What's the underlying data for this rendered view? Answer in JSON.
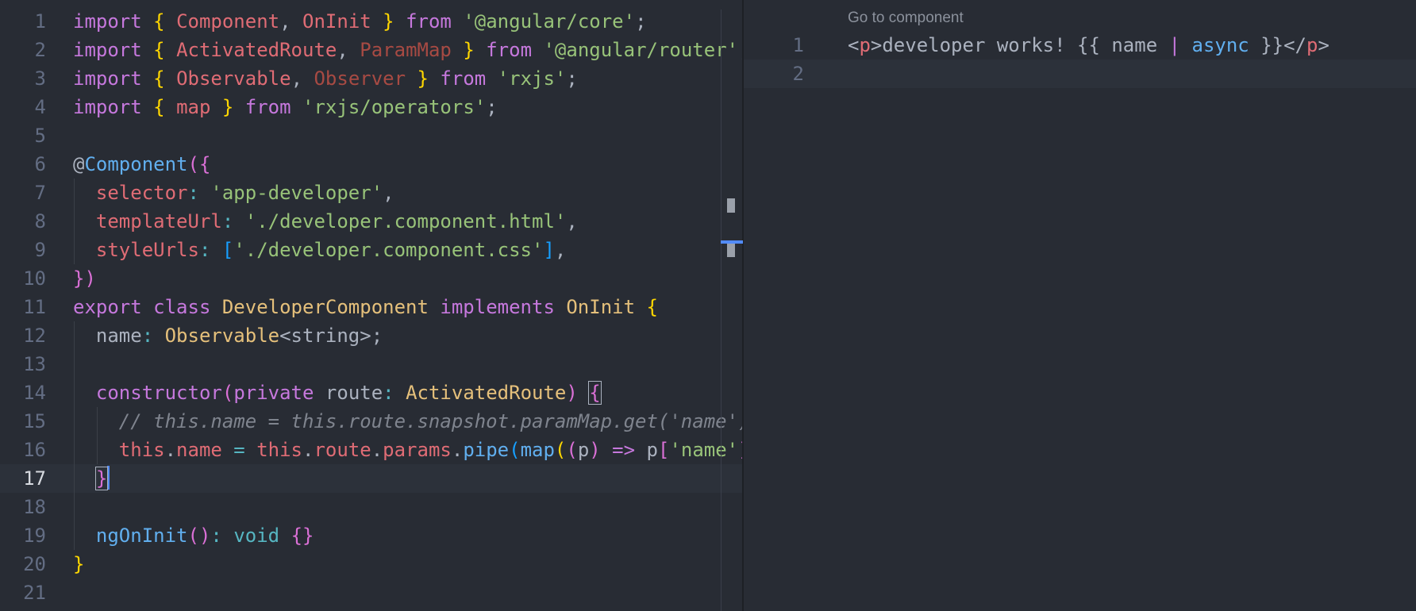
{
  "left_editor": {
    "active_line": 17,
    "line_numbers": [
      "1",
      "2",
      "3",
      "4",
      "5",
      "6",
      "7",
      "8",
      "9",
      "10",
      "11",
      "12",
      "13",
      "14",
      "15",
      "16",
      "17",
      "18",
      "19",
      "20",
      "21"
    ],
    "lines": [
      [
        {
          "t": "import",
          "c": "k"
        },
        {
          "t": " ",
          "c": "p"
        },
        {
          "t": "{",
          "c": "b1"
        },
        {
          "t": " ",
          "c": "p"
        },
        {
          "t": "Component",
          "c": "r"
        },
        {
          "t": ", ",
          "c": "p"
        },
        {
          "t": "OnInit",
          "c": "r"
        },
        {
          "t": " ",
          "c": "p"
        },
        {
          "t": "}",
          "c": "b1"
        },
        {
          "t": " ",
          "c": "p"
        },
        {
          "t": "from",
          "c": "k"
        },
        {
          "t": " ",
          "c": "p"
        },
        {
          "t": "'@angular/core'",
          "c": "s"
        },
        {
          "t": ";",
          "c": "p"
        }
      ],
      [
        {
          "t": "import",
          "c": "k"
        },
        {
          "t": " ",
          "c": "p"
        },
        {
          "t": "{",
          "c": "b1"
        },
        {
          "t": " ",
          "c": "p"
        },
        {
          "t": "ActivatedRoute",
          "c": "r"
        },
        {
          "t": ", ",
          "c": "p"
        },
        {
          "t": "ParamMap",
          "c": "dep"
        },
        {
          "t": " ",
          "c": "p"
        },
        {
          "t": "}",
          "c": "b1"
        },
        {
          "t": " ",
          "c": "p"
        },
        {
          "t": "from",
          "c": "k"
        },
        {
          "t": " ",
          "c": "p"
        },
        {
          "t": "'@angular/router'",
          "c": "s"
        },
        {
          "t": ";",
          "c": "p"
        }
      ],
      [
        {
          "t": "import",
          "c": "k"
        },
        {
          "t": " ",
          "c": "p"
        },
        {
          "t": "{",
          "c": "b1"
        },
        {
          "t": " ",
          "c": "p"
        },
        {
          "t": "Observable",
          "c": "r"
        },
        {
          "t": ", ",
          "c": "p"
        },
        {
          "t": "Observer",
          "c": "dep"
        },
        {
          "t": " ",
          "c": "p"
        },
        {
          "t": "}",
          "c": "b1"
        },
        {
          "t": " ",
          "c": "p"
        },
        {
          "t": "from",
          "c": "k"
        },
        {
          "t": " ",
          "c": "p"
        },
        {
          "t": "'rxjs'",
          "c": "s"
        },
        {
          "t": ";",
          "c": "p"
        }
      ],
      [
        {
          "t": "import",
          "c": "k"
        },
        {
          "t": " ",
          "c": "p"
        },
        {
          "t": "{",
          "c": "b1"
        },
        {
          "t": " ",
          "c": "p"
        },
        {
          "t": "map",
          "c": "r"
        },
        {
          "t": " ",
          "c": "p"
        },
        {
          "t": "}",
          "c": "b1"
        },
        {
          "t": " ",
          "c": "p"
        },
        {
          "t": "from",
          "c": "k"
        },
        {
          "t": " ",
          "c": "p"
        },
        {
          "t": "'rxjs/operators'",
          "c": "s"
        },
        {
          "t": ";",
          "c": "p"
        }
      ],
      [],
      [
        {
          "t": "@",
          "c": "p"
        },
        {
          "t": "Component",
          "c": "f"
        },
        {
          "t": "(",
          "c": "b2"
        },
        {
          "t": "{",
          "c": "b2"
        }
      ],
      [
        {
          "t": "  ",
          "c": "p"
        },
        {
          "t": "selector",
          "c": "r"
        },
        {
          "t": ": ",
          "c": "cy"
        },
        {
          "t": "'app-developer'",
          "c": "s"
        },
        {
          "t": ",",
          "c": "p"
        }
      ],
      [
        {
          "t": "  ",
          "c": "p"
        },
        {
          "t": "templateUrl",
          "c": "r"
        },
        {
          "t": ": ",
          "c": "cy"
        },
        {
          "t": "'./developer.component.html'",
          "c": "s"
        },
        {
          "t": ",",
          "c": "p"
        }
      ],
      [
        {
          "t": "  ",
          "c": "p"
        },
        {
          "t": "styleUrls",
          "c": "r"
        },
        {
          "t": ": ",
          "c": "cy"
        },
        {
          "t": "[",
          "c": "b3"
        },
        {
          "t": "'./developer.component.css'",
          "c": "s"
        },
        {
          "t": "]",
          "c": "b3"
        },
        {
          "t": ",",
          "c": "p"
        }
      ],
      [
        {
          "t": "}",
          "c": "b2"
        },
        {
          "t": ")",
          "c": "b2"
        }
      ],
      [
        {
          "t": "export",
          "c": "k"
        },
        {
          "t": " ",
          "c": "p"
        },
        {
          "t": "class",
          "c": "k"
        },
        {
          "t": " ",
          "c": "p"
        },
        {
          "t": "DeveloperComponent",
          "c": "t"
        },
        {
          "t": " ",
          "c": "p"
        },
        {
          "t": "implements",
          "c": "k"
        },
        {
          "t": " ",
          "c": "p"
        },
        {
          "t": "OnInit",
          "c": "t"
        },
        {
          "t": " ",
          "c": "p"
        },
        {
          "t": "{",
          "c": "b1"
        }
      ],
      [
        {
          "t": "  ",
          "c": "p"
        },
        {
          "t": "name",
          "c": "p"
        },
        {
          "t": ": ",
          "c": "cy"
        },
        {
          "t": "Observable",
          "c": "t"
        },
        {
          "t": "<string>;",
          "c": "p"
        }
      ],
      [],
      [
        {
          "t": "  ",
          "c": "p"
        },
        {
          "t": "constructor",
          "c": "k"
        },
        {
          "t": "(",
          "c": "b2"
        },
        {
          "t": "private",
          "c": "k"
        },
        {
          "t": " route",
          "c": "p"
        },
        {
          "t": ": ",
          "c": "cy"
        },
        {
          "t": "ActivatedRoute",
          "c": "t"
        },
        {
          "t": ")",
          "c": "b2"
        },
        {
          "t": " ",
          "c": "p"
        },
        {
          "t": "{",
          "c": "b2",
          "box": true
        }
      ],
      [
        {
          "t": "    ",
          "c": "p"
        },
        {
          "t": "// this.name = this.route.snapshot.paramMap.get('name');",
          "c": "c"
        }
      ],
      [
        {
          "t": "    ",
          "c": "p"
        },
        {
          "t": "this",
          "c": "r"
        },
        {
          "t": ".",
          "c": "p"
        },
        {
          "t": "name",
          "c": "r"
        },
        {
          "t": " = ",
          "c": "cy"
        },
        {
          "t": "this",
          "c": "r"
        },
        {
          "t": ".",
          "c": "p"
        },
        {
          "t": "route",
          "c": "r"
        },
        {
          "t": ".",
          "c": "p"
        },
        {
          "t": "params",
          "c": "r"
        },
        {
          "t": ".",
          "c": "p"
        },
        {
          "t": "pipe",
          "c": "f"
        },
        {
          "t": "(",
          "c": "b3"
        },
        {
          "t": "map",
          "c": "f"
        },
        {
          "t": "(",
          "c": "b1"
        },
        {
          "t": "(",
          "c": "b2"
        },
        {
          "t": "p",
          "c": "p"
        },
        {
          "t": ")",
          "c": "b2"
        },
        {
          "t": " => ",
          "c": "k"
        },
        {
          "t": "p",
          "c": "p"
        },
        {
          "t": "[",
          "c": "b2"
        },
        {
          "t": "'name'",
          "c": "s"
        },
        {
          "t": "]",
          "c": "b2"
        }
      ],
      [
        {
          "t": "  ",
          "c": "p"
        },
        {
          "t": "}",
          "c": "b2",
          "cursor": true
        }
      ],
      [],
      [
        {
          "t": "  ",
          "c": "p"
        },
        {
          "t": "ngOnInit",
          "c": "f"
        },
        {
          "t": "()",
          "c": "b2"
        },
        {
          "t": ": ",
          "c": "cy"
        },
        {
          "t": "void",
          "c": "cy"
        },
        {
          "t": " ",
          "c": "p"
        },
        {
          "t": "{}",
          "c": "b2"
        }
      ],
      [
        {
          "t": "}",
          "c": "b1"
        }
      ],
      []
    ]
  },
  "right_editor": {
    "codelens": "Go to component",
    "line_numbers": [
      "1",
      "2"
    ],
    "lines": [
      [
        {
          "t": "<",
          "c": "p"
        },
        {
          "t": "p",
          "c": "tag"
        },
        {
          "t": ">developer works! {{ name ",
          "c": "p"
        },
        {
          "t": "|",
          "c": "k"
        },
        {
          "t": " ",
          "c": "p"
        },
        {
          "t": "async",
          "c": "f"
        },
        {
          "t": " }}</",
          "c": "p"
        },
        {
          "t": "p",
          "c": "tag"
        },
        {
          "t": ">",
          "c": "p"
        }
      ],
      []
    ]
  },
  "colors": {
    "background": "#282c34",
    "line_numbers": "#636d83",
    "keyword": "#c678dd",
    "string": "#98c379",
    "type": "#e5c07b",
    "variable": "#e06c75",
    "function": "#61afef",
    "cursor": "#528bff"
  }
}
